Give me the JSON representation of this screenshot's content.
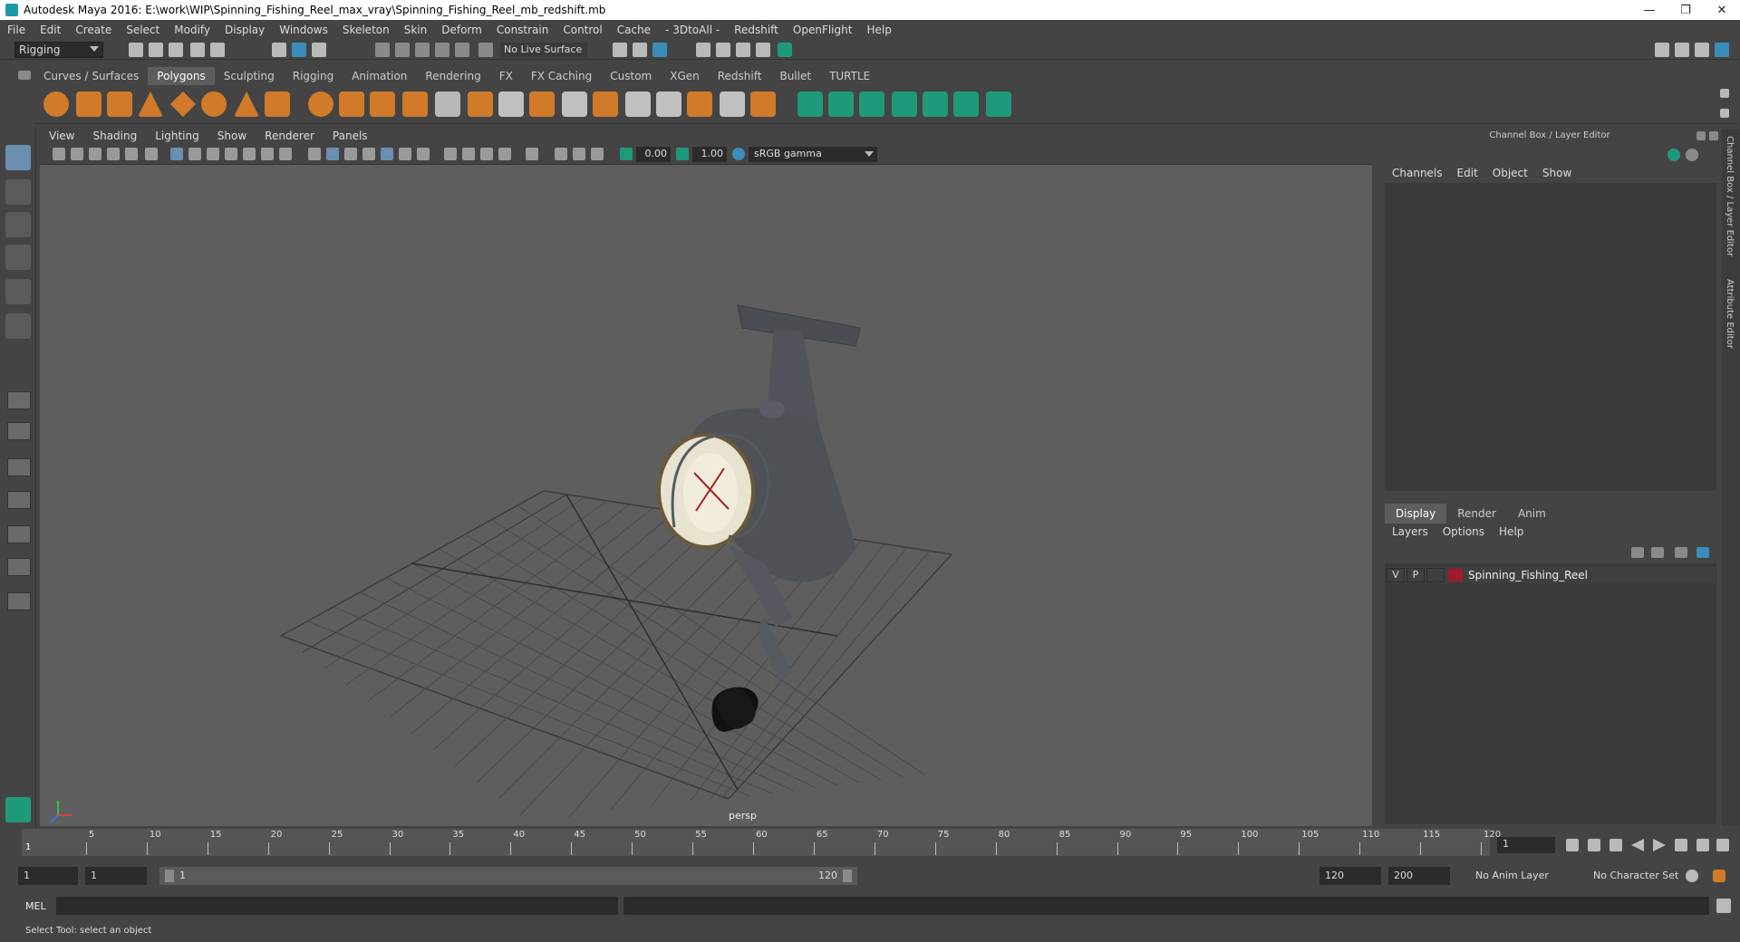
{
  "window": {
    "title": "Autodesk Maya 2016: E:\\work\\WIP\\Spinning_Fishing_Reel_max_vray\\Spinning_Fishing_Reel_mb_redshift.mb",
    "minimize": "—",
    "restore": "❐",
    "close": "✕"
  },
  "menubar": [
    "File",
    "Edit",
    "Create",
    "Select",
    "Modify",
    "Display",
    "Windows",
    "Skeleton",
    "Skin",
    "Deform",
    "Constrain",
    "Control",
    "Cache",
    "- 3DtoAll -",
    "Redshift",
    "OpenFlight",
    "Help"
  ],
  "statusline": {
    "mode": "Rigging",
    "live_surface": "No Live Surface"
  },
  "shelf_tabs": [
    "Curves / Surfaces",
    "Polygons",
    "Sculpting",
    "Rigging",
    "Animation",
    "Rendering",
    "FX",
    "FX Caching",
    "Custom",
    "XGen",
    "Redshift",
    "Bullet",
    "TURTLE"
  ],
  "active_shelf": "Polygons",
  "viewport": {
    "menu": [
      "View",
      "Shading",
      "Lighting",
      "Show",
      "Renderer",
      "Panels"
    ],
    "exposure": "0.00",
    "gamma": "1.00",
    "color_space": "sRGB gamma",
    "camera_label": "persp"
  },
  "channel_box": {
    "title": "Channel Box / Layer Editor",
    "menu": [
      "Channels",
      "Edit",
      "Object",
      "Show"
    ]
  },
  "layer_editor": {
    "tabs": [
      "Display",
      "Render",
      "Anim"
    ],
    "active_tab": "Display",
    "menu": [
      "Layers",
      "Options",
      "Help"
    ],
    "layers": [
      {
        "v": "V",
        "p": "P",
        "name": "Spinning_Fishing_Reel",
        "color": "#a01a2c"
      }
    ]
  },
  "side_tabs": [
    "Channel Box / Layer Editor",
    "Attribute Editor"
  ],
  "timeline": {
    "ticks": [
      "5",
      "10",
      "15",
      "20",
      "25",
      "30",
      "35",
      "40",
      "45",
      "50",
      "55",
      "60",
      "65",
      "70",
      "75",
      "80",
      "85",
      "90",
      "95",
      "100",
      "105",
      "110",
      "115",
      "120"
    ],
    "start_label": "1",
    "current_frame": "1"
  },
  "range": {
    "start": "1",
    "start_inner": "1",
    "slider_start": "1",
    "slider_end": "120",
    "end": "120",
    "end_outer": "200",
    "anim_layer": "No Anim Layer",
    "character_set": "No Character Set"
  },
  "mel": {
    "label": "MEL"
  },
  "help_line": "Select Tool: select an object"
}
